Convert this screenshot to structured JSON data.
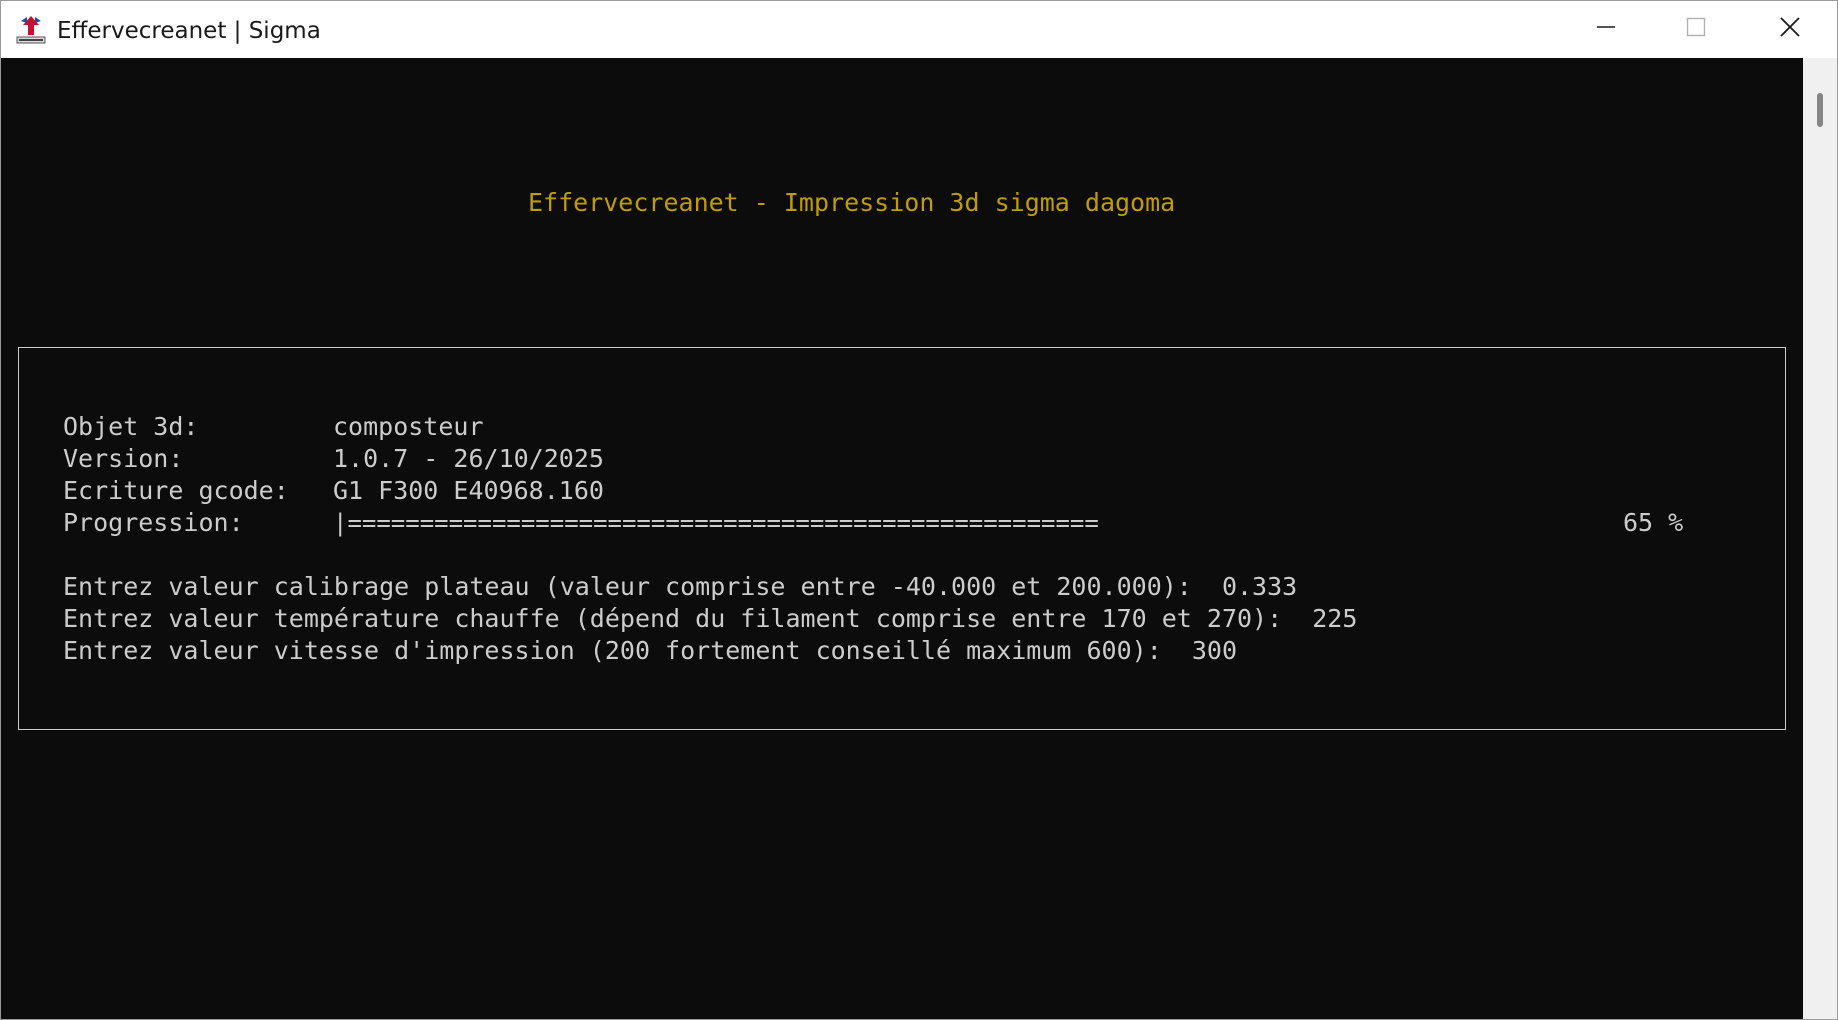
{
  "window": {
    "title": "Effervecreanet | Sigma",
    "icon": "app-logo-icon",
    "controls": {
      "minimize_icon": "minimize-icon",
      "maximize_icon": "maximize-icon",
      "close_icon": "close-icon"
    }
  },
  "console": {
    "header": "Effervecreanet - Impression 3d sigma dagoma",
    "fields": {
      "object_label": "Objet 3d:",
      "object_value": "composteur",
      "version_label": "Version:",
      "version_value": "1.0.7 - 26/10/2025",
      "gcode_label": "Ecriture gcode:",
      "gcode_value": "G1 F300 E40968.160",
      "progress_label": "Progression:",
      "progress_bar": "|====================================================",
      "progress_percent": "65 %"
    },
    "prompts": {
      "calibration": "Entrez valeur calibrage plateau (valeur comprise entre -40.000 et 200.000):  0.333",
      "temperature": "Entrez valeur température chauffe (dépend du filament comprise entre 170 et 270):  225",
      "speed": "Entrez valeur vitesse d'impression (200 fortement conseillé maximum 600):  300"
    },
    "colors": {
      "background": "#0c0c0c",
      "text": "#cccccc",
      "header": "#c19c00"
    }
  }
}
